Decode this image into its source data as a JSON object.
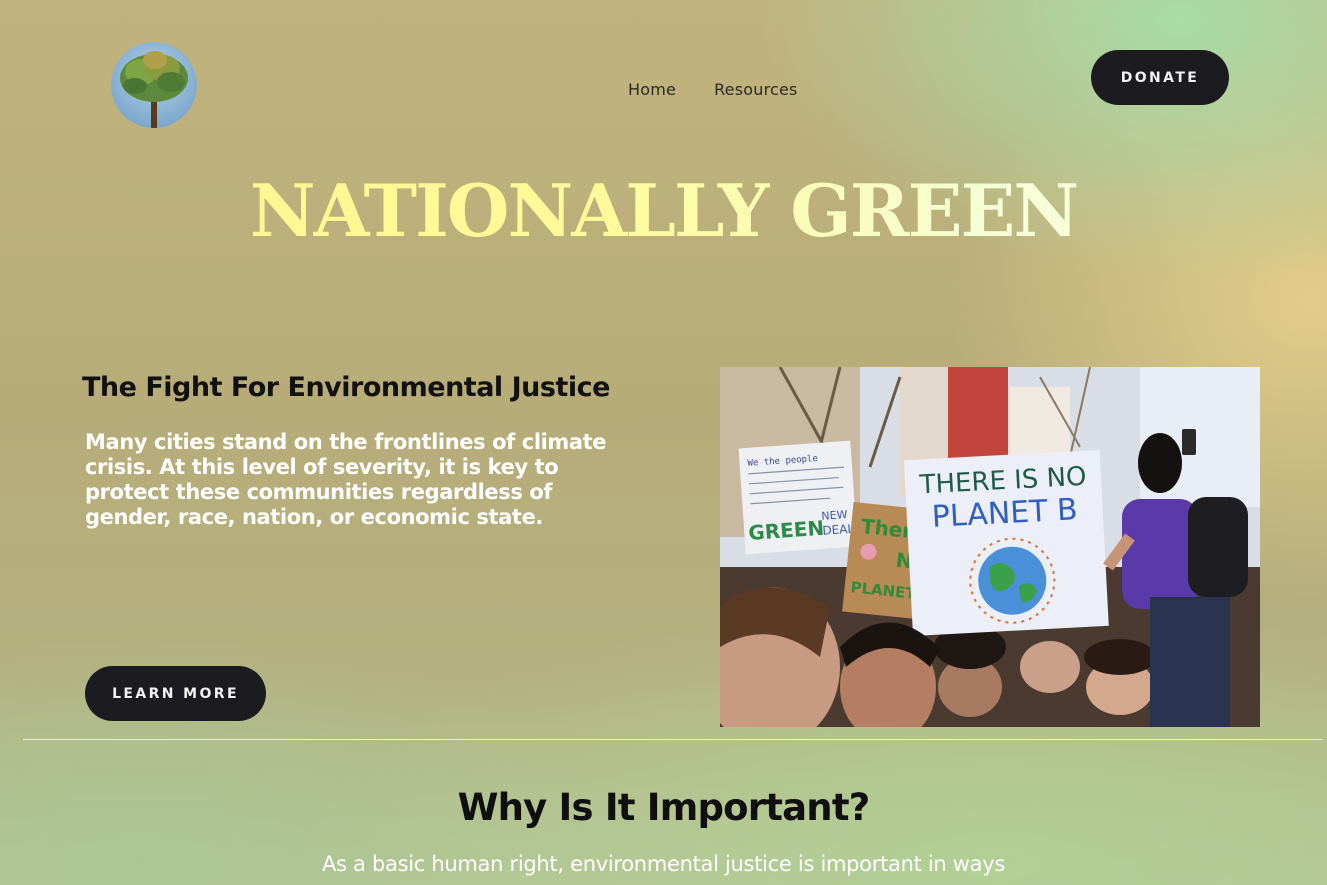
{
  "header": {
    "logo_icon": "tree-logo-icon",
    "nav": [
      {
        "label": "Home"
      },
      {
        "label": "Resources"
      }
    ],
    "donate_label": "DONATE"
  },
  "hero": {
    "title": "NATIONALLY GREEN"
  },
  "section": {
    "heading": "The Fight For Environmental Justice",
    "body": "Many cities stand on the frontlines of climate crisis. At this level of severity, it is key to protect these communities regardless of gender, race, nation, or economic state.",
    "button_label": "LEARN MORE",
    "photo": {
      "sign_main_line1": "THERE IS NO",
      "sign_main_line2": "PLANET B",
      "sign_left_line1": "GREEN",
      "sign_left_line2": "NEW",
      "sign_left_line3": "DEAL",
      "sign_cardboard_line1": "Ther",
      "sign_cardboard_line2": "N",
      "sign_cardboard_line3": "PLANET",
      "sign_note": "We the people"
    }
  },
  "why": {
    "heading": "Why Is It Important?",
    "body": "As a basic human right, environmental justice is important in ways"
  },
  "colors": {
    "button_bg": "#1b1b20",
    "title_gradient_start": "#fff48e",
    "title_gradient_end": "#ffffe0"
  }
}
